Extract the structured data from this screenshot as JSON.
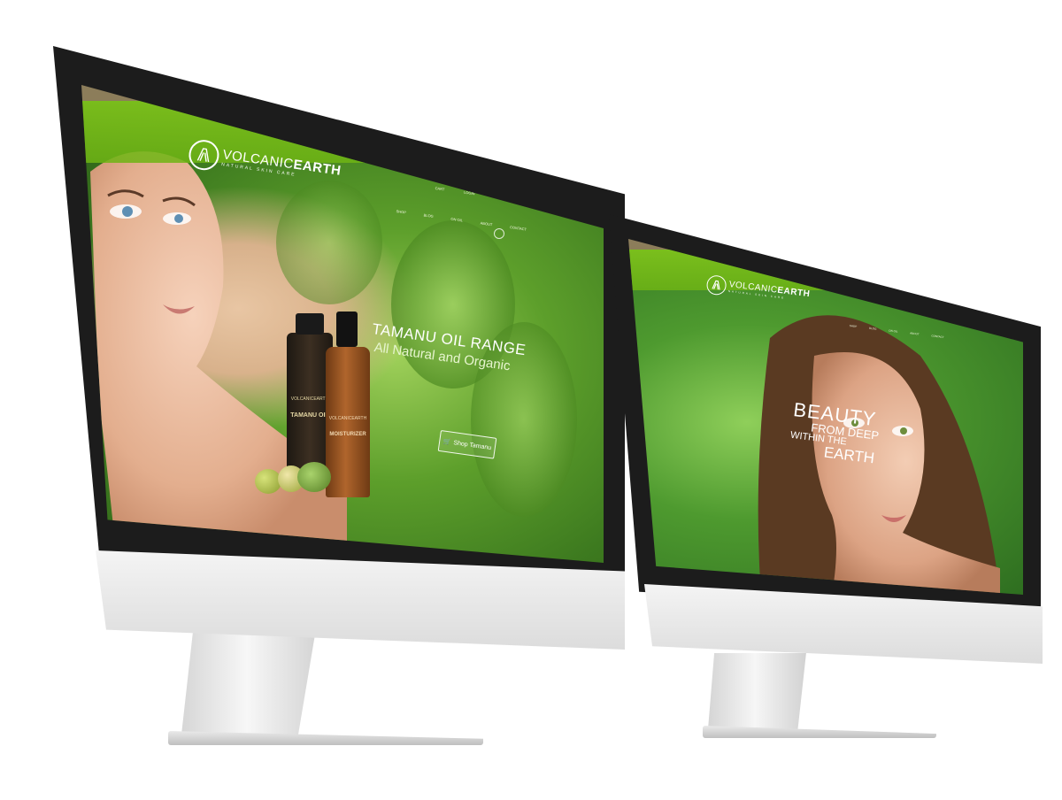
{
  "brand": {
    "name_light": "VOLCANIC",
    "name_bold": "EARTH",
    "tagline": "NATURAL SKIN CARE"
  },
  "nav": [
    "SHOP",
    "BLOG",
    "ON OIL",
    "ABOUT",
    "CONTACT"
  ],
  "left_screen": {
    "utility": [
      "CART",
      "LOGIN",
      "NZ"
    ],
    "hero_title": "TAMANU OIL RANGE",
    "hero_subtitle": "All Natural and Organic",
    "cta_label": "Shop Tamanu",
    "product_1": {
      "brand": "VOLCANICEARTH",
      "name": "TAMANU OIL"
    },
    "product_2": {
      "brand": "VOLCANICEARTH",
      "name": "MOISTURIZER"
    }
  },
  "right_screen": {
    "headline": [
      "BEAUTY",
      "FROM DEEP",
      "WITHIN THE",
      "EARTH"
    ]
  },
  "colors": {
    "brand_green": "#7fc31c",
    "topbar_tan": "#8c7d5a",
    "bezel": "#1c1c1c",
    "aluminum": "#e4e4e4"
  }
}
